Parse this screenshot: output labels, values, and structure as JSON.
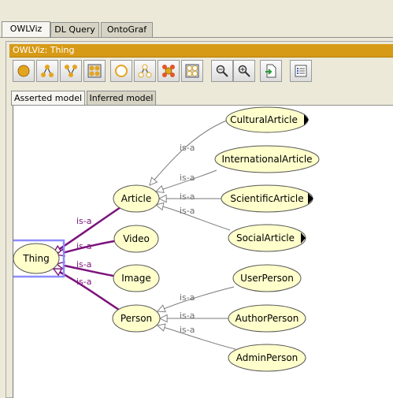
{
  "tabs": [
    {
      "label": "OWLViz",
      "active": true
    },
    {
      "label": "DL Query",
      "active": false
    },
    {
      "label": "OntoGraf",
      "active": false
    }
  ],
  "panel": {
    "title": "OWLViz: Thing"
  },
  "toolbar": {
    "buttons": [
      {
        "name": "show-class-icon"
      },
      {
        "name": "show-subclasses-icon"
      },
      {
        "name": "show-superclasses-icon"
      },
      {
        "name": "show-all-classes-icon"
      },
      {
        "name": "hide-class-icon"
      },
      {
        "name": "hide-subclasses-icon"
      },
      {
        "name": "hide-superclasses-icon"
      },
      {
        "name": "hide-all-classes-icon"
      },
      {
        "name": "zoom-out-icon"
      },
      {
        "name": "zoom-in-icon"
      },
      {
        "name": "export-icon"
      },
      {
        "name": "options-icon"
      }
    ]
  },
  "model_tabs": [
    {
      "label": "Asserted model",
      "active": true
    },
    {
      "label": "Inferred model",
      "active": false
    }
  ],
  "graph": {
    "edge_label": "is-a",
    "nodes": [
      {
        "id": "thing",
        "label": "Thing",
        "selected": true
      },
      {
        "id": "article",
        "label": "Article"
      },
      {
        "id": "video",
        "label": "Video"
      },
      {
        "id": "image",
        "label": "Image"
      },
      {
        "id": "person",
        "label": "Person"
      },
      {
        "id": "cultural",
        "label": "CulturalArticle",
        "has_children": true
      },
      {
        "id": "international",
        "label": "InternationalArticle"
      },
      {
        "id": "scientific",
        "label": "ScientificArticle",
        "has_children": true
      },
      {
        "id": "social",
        "label": "SocialArticle",
        "has_children": true
      },
      {
        "id": "userperson",
        "label": "UserPerson"
      },
      {
        "id": "authorperson",
        "label": "AuthorPerson"
      },
      {
        "id": "adminperson",
        "label": "AdminPerson"
      }
    ]
  },
  "colors": {
    "node_fill": "#ffffcc",
    "accent_edge": "#7b137b",
    "title_bar": "#d79a16",
    "selection": "#8c8cff"
  }
}
